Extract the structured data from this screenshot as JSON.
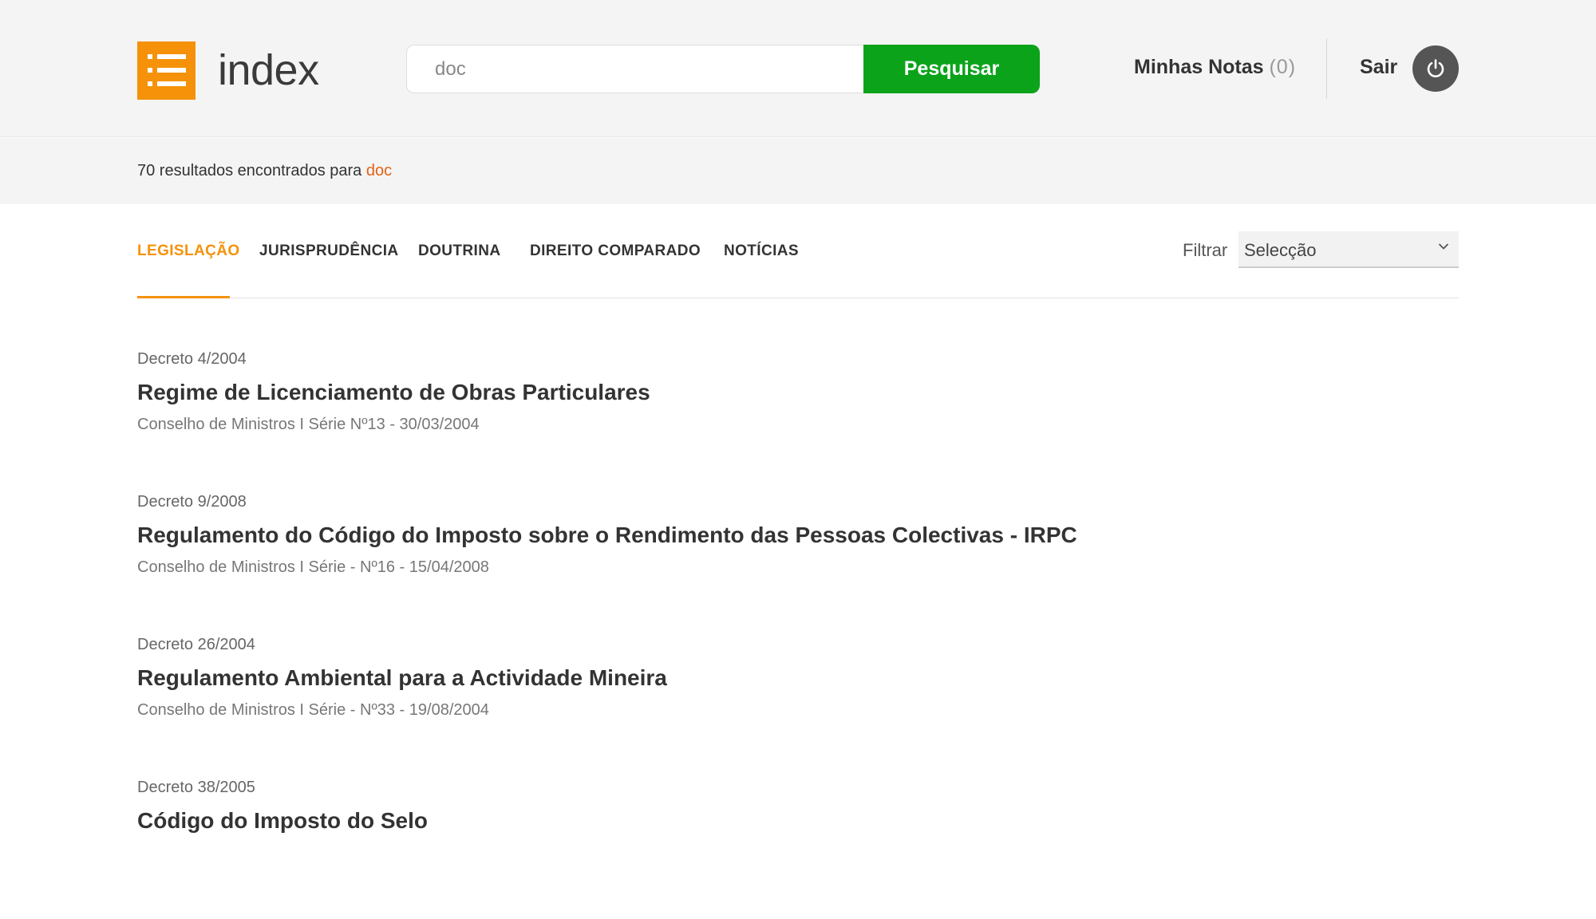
{
  "colors": {
    "accent": "#f5920a",
    "search_button": "#0aa319",
    "highlight": "#e2621b",
    "power_button": "#555555"
  },
  "header": {
    "logo_text": "index",
    "logo_icon": "list-icon",
    "search": {
      "value": "doc",
      "button_label": "Pesquisar"
    },
    "notes": {
      "label": "Minhas Notas",
      "count": "(0)"
    },
    "logout": {
      "label": "Sair",
      "icon": "power-icon"
    }
  },
  "results_bar": {
    "prefix": "70 resultados encontrados para ",
    "term": "doc"
  },
  "tabs": [
    {
      "label": "LEGISLAÇÃO",
      "active": true
    },
    {
      "label": "JURISPRUDÊNCIA",
      "active": false
    },
    {
      "label": "DOUTRINA",
      "active": false
    },
    {
      "label": "DIREITO COMPARADO",
      "active": false
    },
    {
      "label": "NOTÍCIAS",
      "active": false
    }
  ],
  "filter": {
    "label": "Filtrar",
    "selected": "Selecção"
  },
  "results": [
    {
      "type": "Decreto 4/2004",
      "title": "Regime de Licenciamento de Obras Particulares",
      "meta": "Conselho de Ministros I Série Nº13 - 30/03/2004"
    },
    {
      "type": "Decreto 9/2008",
      "title": "Regulamento do Código do Imposto sobre o Rendimento das Pessoas Colectivas - IRPC",
      "meta": "Conselho de Ministros I Série - Nº16 - 15/04/2008"
    },
    {
      "type": "Decreto 26/2004",
      "title": "Regulamento Ambiental para a Actividade Mineira",
      "meta": "Conselho de Ministros I Série - Nº33 - 19/08/2004"
    },
    {
      "type": "Decreto 38/2005",
      "title": "Código do Imposto do Selo",
      "meta": ""
    }
  ]
}
